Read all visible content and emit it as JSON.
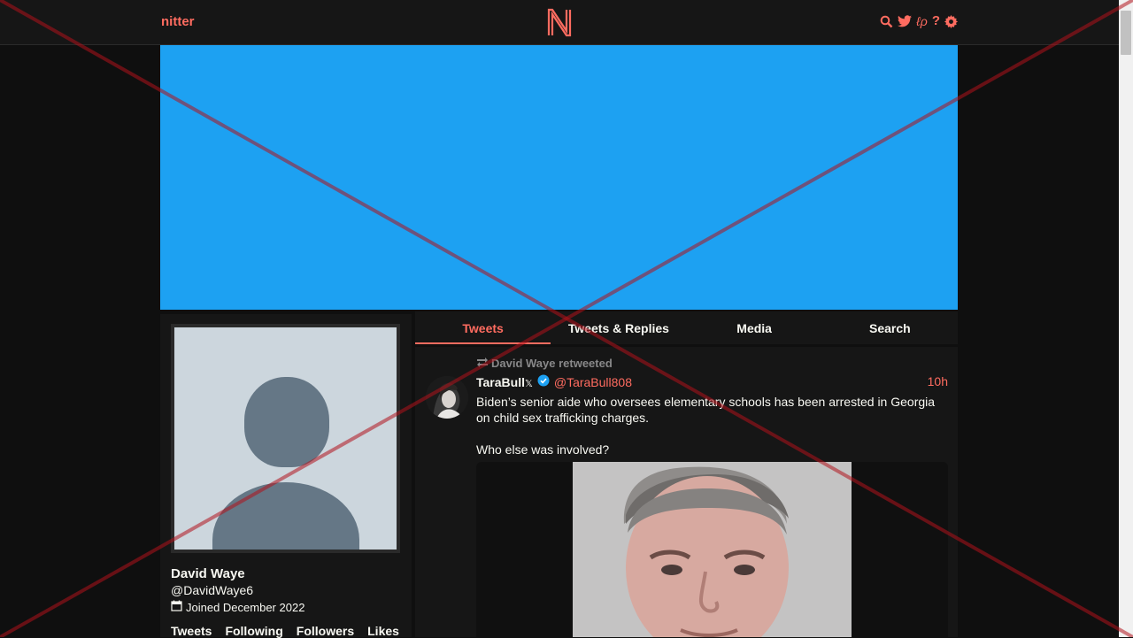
{
  "navbar": {
    "brand": "nitter",
    "logo_letter": "N",
    "icons": [
      "search-icon",
      "twitter-icon",
      "rss-icon",
      "help-icon",
      "gear-icon"
    ],
    "help_glyph": "?",
    "rss_glyph": "ℓρ",
    "accent_color": "#ff6c60"
  },
  "banner": {
    "color": "#1da1f2"
  },
  "profile": {
    "fullname": "David Waye",
    "username": "@DavidWaye6",
    "joined": "Joined December 2022",
    "stats": [
      "Tweets",
      "Following",
      "Followers",
      "Likes"
    ]
  },
  "tabs": [
    {
      "label": "Tweets",
      "active": true
    },
    {
      "label": "Tweets & Replies",
      "active": false
    },
    {
      "label": "Media",
      "active": false
    },
    {
      "label": "Search",
      "active": false
    }
  ],
  "tweet": {
    "retweet_header": "David Waye retweeted",
    "fullname": "TaraBull",
    "name_suffix": "𝕏",
    "verified": true,
    "handle": "@TaraBull808",
    "date": "10h",
    "text": "Biden’s senior aide who oversees elementary schools has been arrested in Georgia on child sex trafficking charges.\n\nWho else was involved?"
  }
}
